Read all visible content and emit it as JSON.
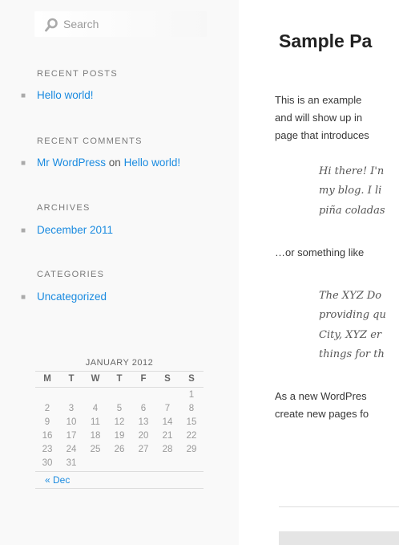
{
  "sidebar": {
    "search": {
      "placeholder": "Search"
    },
    "recent_posts": {
      "title": "RECENT POSTS",
      "items": [
        {
          "label": "Hello world!"
        }
      ]
    },
    "recent_comments": {
      "title": "RECENT COMMENTS",
      "items": [
        {
          "author": "Mr WordPress",
          "on": "on",
          "post": "Hello world!"
        }
      ]
    },
    "archives": {
      "title": "ARCHIVES",
      "items": [
        {
          "label": "December 2011"
        }
      ]
    },
    "categories": {
      "title": "CATEGORIES",
      "items": [
        {
          "label": "Uncategorized"
        }
      ]
    },
    "calendar": {
      "caption": "JANUARY 2012",
      "headers": [
        "M",
        "T",
        "W",
        "T",
        "F",
        "S",
        "S"
      ],
      "rows": [
        [
          "",
          "",
          "",
          "",
          "",
          "",
          "1"
        ],
        [
          "2",
          "3",
          "4",
          "5",
          "6",
          "7",
          "8"
        ],
        [
          "9",
          "10",
          "11",
          "12",
          "13",
          "14",
          "15"
        ],
        [
          "16",
          "17",
          "18",
          "19",
          "20",
          "21",
          "22"
        ],
        [
          "23",
          "24",
          "25",
          "26",
          "27",
          "28",
          "29"
        ],
        [
          "30",
          "31",
          "",
          "",
          "",
          "",
          ""
        ]
      ],
      "prev_link": "« Dec"
    }
  },
  "main": {
    "title": "Sample Pa",
    "paragraph_lines": [
      "This is an example",
      "and will show up in",
      "page that introduces"
    ],
    "quote1_lines": [
      "Hi there! I'n",
      "my blog. I li",
      "piña coladas"
    ],
    "middle_text": "…or something like",
    "quote2_lines": [
      "The XYZ Do",
      "providing qu",
      "City, XYZ er",
      "things for th"
    ],
    "closing_lines": [
      "As a new WordPres",
      "create new pages fo"
    ]
  },
  "colors": {
    "link": "#1b8be0",
    "sidebar_bg": "#f9f9f9"
  }
}
